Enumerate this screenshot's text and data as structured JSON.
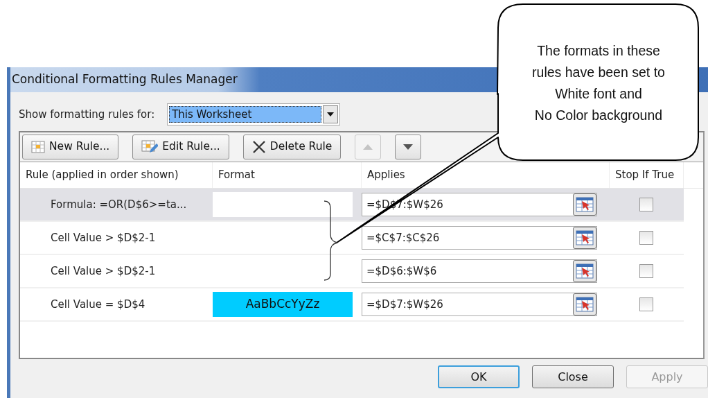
{
  "window": {
    "title": "Conditional Formatting Rules Manager"
  },
  "scope": {
    "label": "Show formatting rules for:",
    "value": "This Worksheet"
  },
  "toolbar": [
    {
      "kind": "new",
      "label": "New Rule...",
      "disabled": false
    },
    {
      "kind": "edit",
      "label": "Edit Rule...",
      "disabled": false
    },
    {
      "kind": "delete",
      "label": "Delete Rule",
      "disabled": false
    },
    {
      "kind": "up",
      "disabled": true
    },
    {
      "kind": "down",
      "disabled": false
    }
  ],
  "table": {
    "columns": [
      "Rule (applied in order shown)",
      "Format",
      "Applies",
      "Stop If True"
    ],
    "rows": [
      {
        "rule": "Formula: =OR(D$6>=ta...",
        "color": "#ffffff",
        "applies_to": "=$D$7:$W$26",
        "stop_if_true": false,
        "selected": true
      },
      {
        "rule": "Cell Value > $D$2-1",
        "applies_to": "=$C$7:$C$26",
        "stop_if_true": false,
        "selected": false
      },
      {
        "rule": "Cell Value > $D$2-1",
        "applies_to": "=$D$6:$W$6",
        "stop_if_true": false,
        "selected": false
      },
      {
        "rule": "Cell Value = $D$4",
        "color": "#00ccff",
        "format_sample": "AaBbCcYyZz",
        "applies_to": "=$D$7:$W$26",
        "stop_if_true": false,
        "selected": false
      }
    ]
  },
  "buttons": [
    {
      "label": "OK",
      "focused": true,
      "disabled": false
    },
    {
      "label": "Close",
      "focused": false,
      "disabled": false
    },
    {
      "label": "Apply",
      "focused": false,
      "disabled": true
    }
  ],
  "callout": {
    "text": "The formats in these\nrules have been set to\nWhite font and\nNo Color background"
  }
}
